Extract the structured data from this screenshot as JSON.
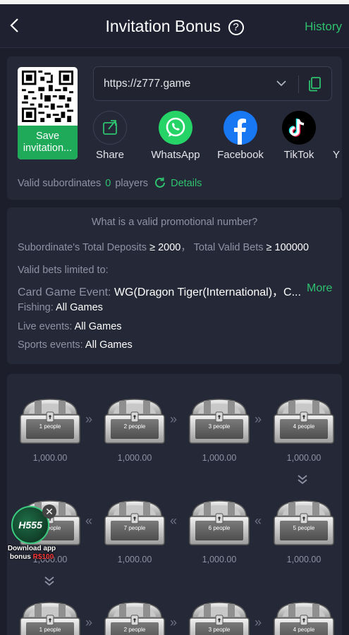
{
  "header": {
    "title": "Invitation Bonus",
    "help_glyph": "?",
    "history_label": "History",
    "back_icon": "chevron-left-icon"
  },
  "invite": {
    "qr_label": "Save invitation...",
    "url": "https://z777.game",
    "shares": [
      {
        "label": "Share",
        "icon": "share-icon"
      },
      {
        "label": "WhatsApp",
        "icon": "whatsapp-icon"
      },
      {
        "label": "Facebook",
        "icon": "facebook-icon"
      },
      {
        "label": "TikTok",
        "icon": "tiktok-icon"
      },
      {
        "label": "Y",
        "icon": "more-share-icon"
      }
    ],
    "valid_label": "Valid subordinates",
    "valid_count": "0",
    "players_label": "players",
    "details_label": "Details"
  },
  "rules": {
    "question": "What is a valid promotional number?",
    "deposits_label": "Subordinate's Total Deposits",
    "ge": "≥",
    "deposits_value": "2000",
    "bets_label": "Total Valid Bets",
    "bets_value": "100000",
    "limited_label": "Valid bets limited to:",
    "card_label": "Card Game Event:",
    "card_value": "WG(Dragon Tiger(International)，C...",
    "more_label": "More",
    "fishing_label": "Fishing:",
    "fishing_value": "All Games",
    "live_label": "Live events:",
    "live_value": "All Games",
    "sports_label": "Sports events:",
    "sports_value": "All Games"
  },
  "chests": {
    "row1": [
      {
        "people": "1 people",
        "amount": "1,000.00"
      },
      {
        "people": "2 people",
        "amount": "1,000.00"
      },
      {
        "people": "3 people",
        "amount": "1,000.00"
      },
      {
        "people": "4 people",
        "amount": "1,000.00"
      }
    ],
    "row2": [
      {
        "people": "8 people",
        "amount": "1,000.00"
      },
      {
        "people": "7 people",
        "amount": "1,000.00"
      },
      {
        "people": "6 people",
        "amount": "1,000.00"
      },
      {
        "people": "5 people",
        "amount": "1,000.00"
      }
    ],
    "arrow_right": "»",
    "arrow_left": "«"
  },
  "promo": {
    "logo_text": "H555",
    "close_glyph": "✕",
    "line1": "Download app",
    "line2_prefix": "bonus ",
    "line2_amount": "R$100"
  },
  "colors": {
    "accent": "#2ec26f",
    "background": "#1c1e2b",
    "card": "#252837"
  }
}
